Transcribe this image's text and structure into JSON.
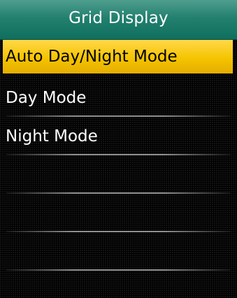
{
  "header": {
    "title": "Grid Display"
  },
  "menu": {
    "items": [
      {
        "label": "Auto Day/Night Mode",
        "selected": true
      },
      {
        "label": "Day Mode",
        "selected": false
      },
      {
        "label": "Night Mode",
        "selected": false
      }
    ]
  },
  "colors": {
    "header": "#23806f",
    "highlight": "#f5c400",
    "background": "#000000"
  }
}
